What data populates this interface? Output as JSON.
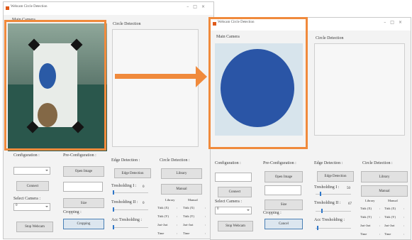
{
  "window1": {
    "title": "Webcam Circle Detection",
    "main_label": "Main Camera",
    "circle_label": "Circle Detection",
    "config_label": "Configuration :",
    "preconfig_label": "Pre-Configuration :",
    "edge_label": "Edge Detection :",
    "circle_detection_label": "Circle Detection :",
    "open_image_btn": "Open Image",
    "connect_btn": "Connect",
    "select_camera_label": "Select Camera :",
    "camera_value": "0",
    "size_btn": "Size",
    "cropping_label": "Cropping :",
    "cropping_btn": "Cropping",
    "stop_webcam_btn": "Stop Webcam",
    "edge_detection_btn": "Edge Detection",
    "threshold1_label": "Tresholding I :",
    "threshold1_value": "0",
    "threshold2_label": "Tresholding II :",
    "threshold2_value": "0",
    "acc_threshold_label": "Acc Tresholding :",
    "library_btn": "Library",
    "manual_btn": "Manual",
    "table": {
      "headers": [
        "Library",
        "Manual"
      ],
      "rows": [
        [
          "Titik (X)",
          ":",
          "Titik (X)",
          ":"
        ],
        [
          "Titik (Y)",
          ":",
          "Titik (Y)",
          ":"
        ],
        [
          "Jari-Jari",
          ":",
          "Jari-Jari",
          ":"
        ],
        [
          "Time",
          ":",
          "Time",
          ":"
        ]
      ]
    }
  },
  "window2": {
    "title": "Webcam Circle Detection",
    "main_label": "Main Camera",
    "circle_label": "Circle Detection",
    "config_label": "Configuration :",
    "preconfig_label": "Pre-Configuration :",
    "edge_label": "Edge Detection :",
    "circle_detection_label": "Circle Detection :",
    "open_image_btn": "Open Image",
    "connect_btn": "Connect",
    "select_camera_label": "Select Camera :",
    "camera_value": "0",
    "size_btn": "Size",
    "cropping_label": "Cropping :",
    "cancel_btn": "Cancel",
    "stop_webcam_btn": "Stop Webcam",
    "edge_detection_btn": "Edge Detection",
    "threshold1_label": "Tresholding I :",
    "threshold1_value": "50",
    "threshold2_label": "Tresholding II :",
    "threshold2_value": "67",
    "acc_threshold_label": "Acc Tresholding :",
    "library_btn": "Library",
    "manual_btn": "Manual",
    "table": {
      "headers": [
        "Library",
        "Manual"
      ],
      "rows": [
        [
          "Titik (X)",
          ":",
          "Titik (X)",
          ":"
        ],
        [
          "Titik (Y)",
          ":",
          "Titik (Y)",
          ":"
        ],
        [
          "Jari-Jari",
          ":",
          "Jari-Jari",
          ":"
        ],
        [
          "Time",
          ":",
          "Time",
          ":"
        ]
      ]
    }
  },
  "colors": {
    "highlight": "#f08a3c",
    "accent": "#2f77c9"
  },
  "sliders": {
    "threshold1_w1": 0,
    "threshold2_w1": 0,
    "acc_w1": 0,
    "threshold1_w2": 0.0,
    "threshold2_w2": 0.0,
    "acc_w2": 0.0
  }
}
